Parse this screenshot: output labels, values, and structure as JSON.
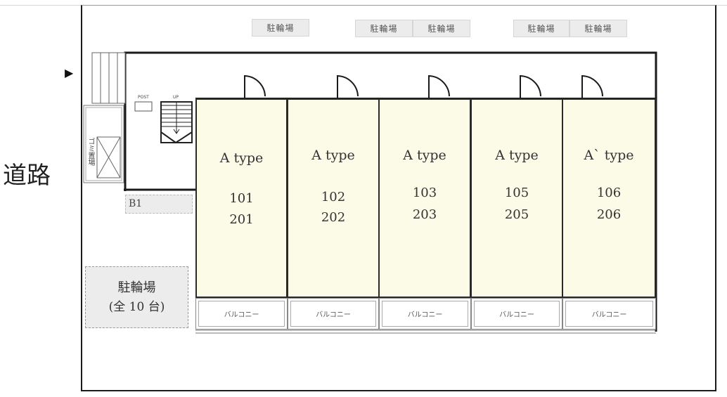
{
  "road_label": "道路",
  "entry_marker": "▶",
  "top_parking_tags": [
    "駐輪場",
    "駐輪場",
    "駐輪場",
    "駐輪場",
    "駐輪場"
  ],
  "garbage_label": "ゴミ置場",
  "post_label": "POST",
  "up_label": "UP",
  "b1_label": "B1",
  "bike_parking": {
    "label": "駐輪場",
    "capacity": "(全 10 台)"
  },
  "units": [
    {
      "type": "A type",
      "rooms": [
        "101",
        "201"
      ]
    },
    {
      "type": "A type",
      "rooms": [
        "102",
        "202"
      ]
    },
    {
      "type": "A type",
      "rooms": [
        "103",
        "203"
      ]
    },
    {
      "type": "A type",
      "rooms": [
        "105",
        "205"
      ]
    },
    {
      "type": "A` type",
      "rooms": [
        "106",
        "206"
      ]
    }
  ],
  "balcony_label": "バルコニー",
  "colors": {
    "unit_fill": "#fcfbe8",
    "tag_fill": "#ececec",
    "wall": "#1a1a1a"
  }
}
